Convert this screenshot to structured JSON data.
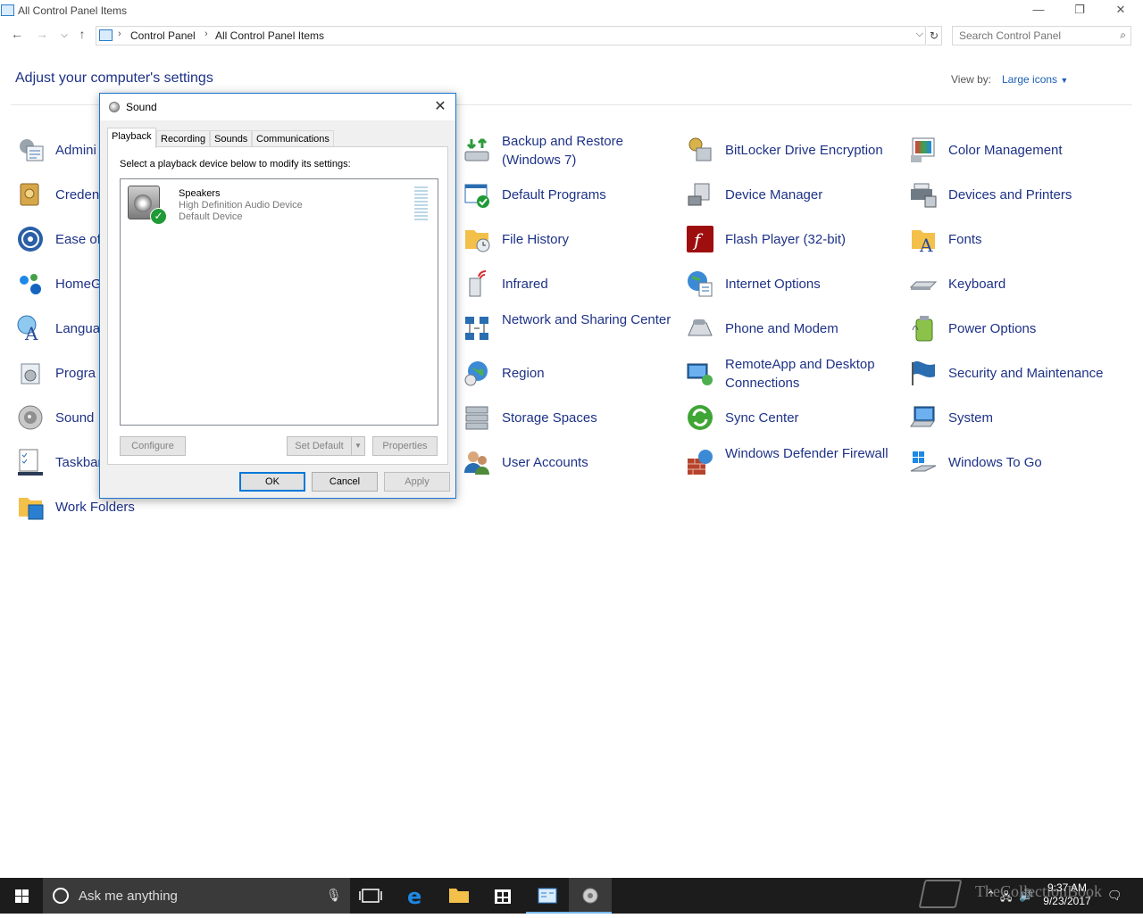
{
  "window": {
    "title": "All Control Panel Items"
  },
  "address": {
    "crumbs": [
      "Control Panel",
      "All Control Panel Items"
    ],
    "search_placeholder": "Search Control Panel"
  },
  "page": {
    "heading": "Adjust your computer's settings",
    "view_by_label": "View by:",
    "view_by_value": "Large icons"
  },
  "items": {
    "col0": [
      "Admini",
      "Creden",
      "Ease of",
      "HomeG",
      "Langua",
      "Progra",
      "Sound",
      "Taskbar",
      "Work Folders"
    ],
    "col1": [
      "Backup and Restore (Windows 7)",
      "Default Programs",
      "File History",
      "Infrared",
      "Network and Sharing Center",
      "Region",
      "Storage Spaces",
      "User Accounts"
    ],
    "col2": [
      "BitLocker Drive Encryption",
      "Device Manager",
      "Flash Player (32-bit)",
      "Internet Options",
      "Phone and Modem",
      "RemoteApp and Desktop Connections",
      "Sync Center",
      "Windows Defender Firewall"
    ],
    "col3": [
      "Color Management",
      "Devices and Printers",
      "Fonts",
      "Keyboard",
      "Power Options",
      "Security and Maintenance",
      "System",
      "Windows To Go"
    ]
  },
  "dialog": {
    "title": "Sound",
    "tabs": [
      "Playback",
      "Recording",
      "Sounds",
      "Communications"
    ],
    "active_tab": "Playback",
    "instruction": "Select a playback device below to modify its settings:",
    "device": {
      "name": "Speakers",
      "description": "High Definition Audio Device",
      "status": "Default Device"
    },
    "buttons": {
      "configure": "Configure",
      "set_default": "Set Default",
      "properties": "Properties",
      "ok": "OK",
      "cancel": "Cancel",
      "apply": "Apply"
    }
  },
  "taskbar": {
    "search_text": "Ask me anything",
    "time": "9:37 AM",
    "date": "9/23/2017"
  },
  "watermark": "TheCollectionBook",
  "colors": {
    "link": "#1e3287",
    "accent": "#0078d7",
    "taskbar": "#1c1c1c"
  }
}
